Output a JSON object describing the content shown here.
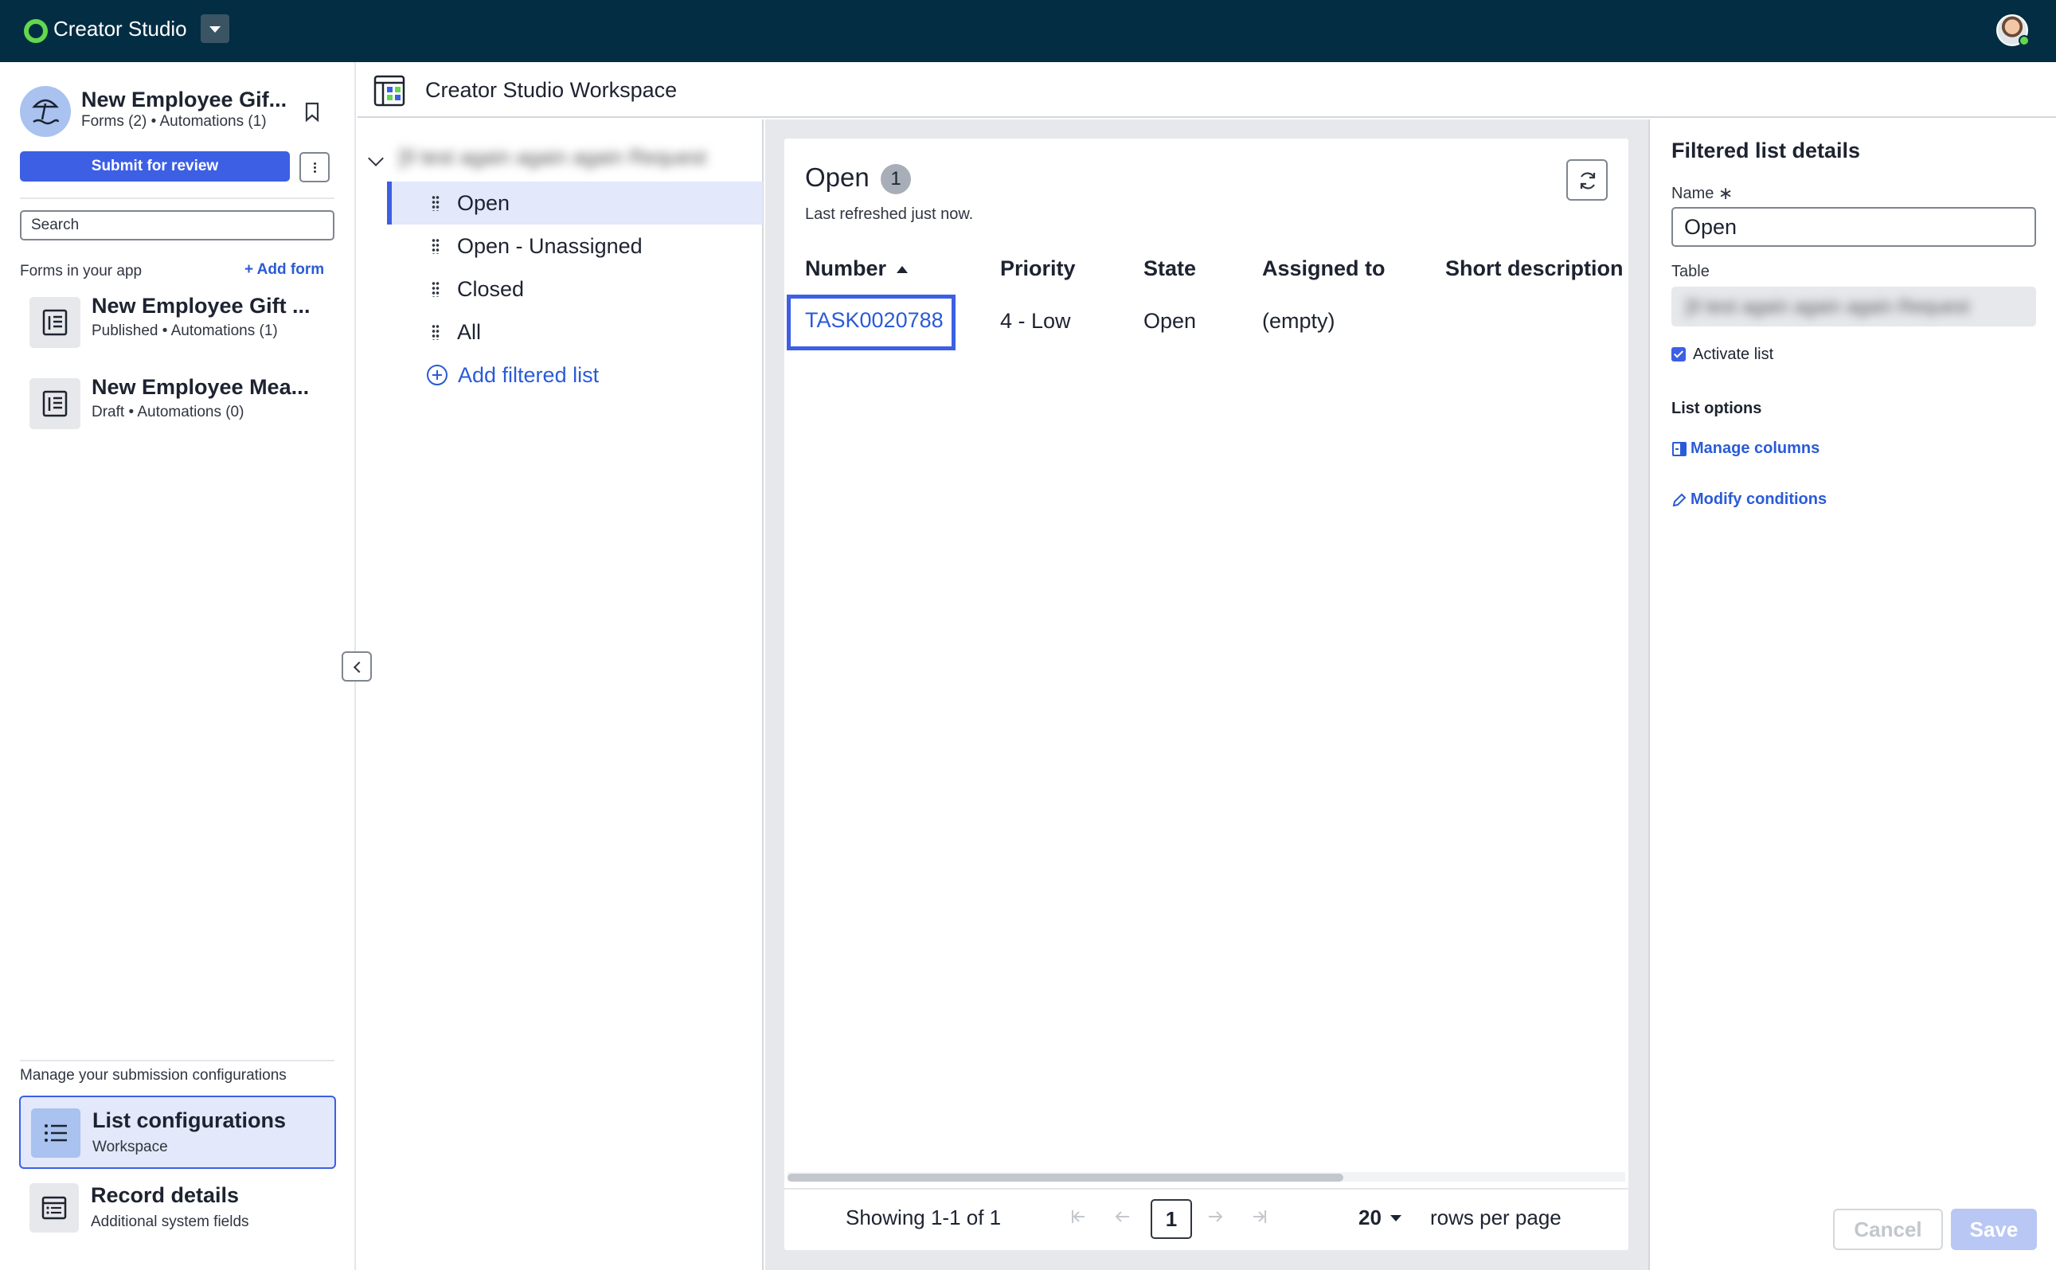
{
  "topbar": {
    "app_title": "Creator Studio"
  },
  "sidebar": {
    "app_name": "New Employee Gif...",
    "app_meta": "Forms (2) • Automations (1)",
    "submit_label": "Submit for review",
    "search_placeholder": "Search",
    "forms_label": "Forms in your app",
    "add_form_label": "+ Add form",
    "forms": [
      {
        "title": "New Employee Gift ...",
        "subtitle": "Published • Automations (1)"
      },
      {
        "title": "New Employee Mea...",
        "subtitle": "Draft • Automations (0)"
      }
    ],
    "config_label": "Manage your submission configurations",
    "configs": [
      {
        "title": "List configurations",
        "subtitle": "Workspace"
      },
      {
        "title": "Record details",
        "subtitle": "Additional system fields"
      }
    ]
  },
  "workspace": {
    "title": "Creator Studio Workspace"
  },
  "tree": {
    "root_label": "[Il test again again again Request",
    "items": [
      "Open",
      "Open - Unassigned",
      "Closed",
      "All"
    ],
    "add_label": "Add filtered list"
  },
  "preview": {
    "title": "Open",
    "count": "1",
    "refreshed": "Last refreshed just now.",
    "columns": [
      "Number",
      "Priority",
      "State",
      "Assigned to",
      "Short description"
    ],
    "rows": [
      {
        "number": "TASK0020788",
        "priority": "4 - Low",
        "state": "Open",
        "assigned_to": "(empty)",
        "short_description": ""
      }
    ],
    "showing": "Showing 1-1 of 1",
    "page": "1",
    "rows_per_page": "20",
    "rows_per_page_label": "rows per page"
  },
  "details": {
    "title": "Filtered list details",
    "name_label": "Name",
    "required_mark": "∗",
    "name_value": "Open",
    "table_label": "Table",
    "table_value": "[Il test again again again Request",
    "activate_label": "Activate list",
    "activate_checked": true,
    "options_label": "List options",
    "manage_columns": "Manage columns",
    "modify_conditions": "Modify conditions",
    "cancel_label": "Cancel",
    "save_label": "Save"
  },
  "colors": {
    "topbar": "#032d42",
    "accent": "#3c5fe4",
    "link": "#2a5bd7",
    "brand_green": "#62d84e"
  }
}
